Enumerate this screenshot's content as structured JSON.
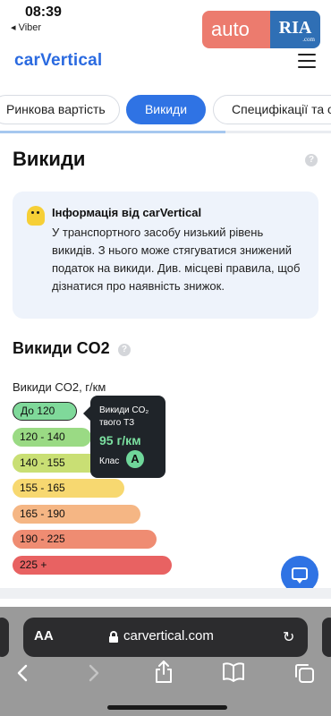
{
  "status_bar": {
    "time": "08:39",
    "back_app": "◂ Viber"
  },
  "ad": {
    "left_text": "auto",
    "right_text": "RIA",
    "right_small": ".com"
  },
  "header": {
    "logo": "carVertical"
  },
  "tabs": [
    "Ринкова вартість",
    "Викиди",
    "Специфікації та ос"
  ],
  "active_tab": "Викиди",
  "main": {
    "title": "Викиди",
    "info": {
      "title": "Інформація від carVertical",
      "text": "У транспортного засобу низький рівень викидів. З нього може стягуватися знижений податок на викиди. Див. місцеві правила, щоб дізнатися про наявність знижок."
    },
    "co2_title": "Викиди CO2",
    "unit_label": "Викиди CO2, г/км",
    "tooltip": {
      "label": "Викиди CO₂ твого ТЗ",
      "value": "95 г/км",
      "class_label": "Клас",
      "class_value": "A"
    }
  },
  "emission_bands": [
    {
      "label": "До 120",
      "color": "#7fd99a"
    },
    {
      "label": "120 - 140",
      "color": "#9ada84"
    },
    {
      "label": "140 - 155",
      "color": "#c9df74"
    },
    {
      "label": "155 - 165",
      "color": "#f7d870"
    },
    {
      "label": "165 - 190",
      "color": "#f5b684"
    },
    {
      "label": "190 - 225",
      "color": "#ef8c72"
    },
    {
      "label": "225 +",
      "color": "#e86262"
    }
  ],
  "browser": {
    "aa": "AA",
    "url": "carvertical.com"
  }
}
